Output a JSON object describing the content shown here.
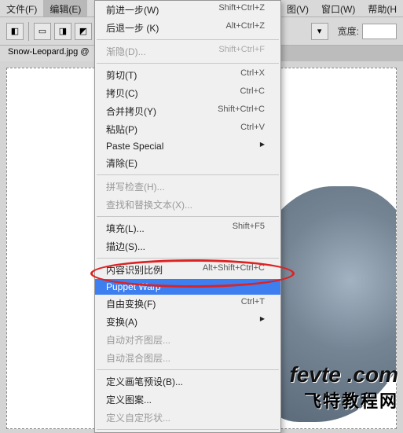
{
  "menubar": {
    "items": [
      "文件(F)",
      "编辑(E)",
      "图(V)",
      "窗口(W)",
      "帮助(H"
    ]
  },
  "toolbar": {
    "width_label": "宽度:"
  },
  "tab": {
    "label": "Snow-Leopard.jpg @"
  },
  "dropdown": {
    "items": [
      {
        "label": "前进一步(W)",
        "shortcut": "Shift+Ctrl+Z",
        "type": "item"
      },
      {
        "label": "后退一步 (K)",
        "shortcut": "Alt+Ctrl+Z",
        "type": "item"
      },
      {
        "type": "sep"
      },
      {
        "label": "渐隐(D)...",
        "shortcut": "Shift+Ctrl+F",
        "type": "item",
        "disabled": true
      },
      {
        "type": "sep"
      },
      {
        "label": "剪切(T)",
        "shortcut": "Ctrl+X",
        "type": "item"
      },
      {
        "label": "拷贝(C)",
        "shortcut": "Ctrl+C",
        "type": "item"
      },
      {
        "label": "合并拷贝(Y)",
        "shortcut": "Shift+Ctrl+C",
        "type": "item"
      },
      {
        "label": "粘贴(P)",
        "shortcut": "Ctrl+V",
        "type": "item"
      },
      {
        "label": "Paste Special",
        "shortcut": "",
        "type": "item",
        "arrow": true
      },
      {
        "label": "清除(E)",
        "shortcut": "",
        "type": "item"
      },
      {
        "type": "sep"
      },
      {
        "label": "拼写检查(H)...",
        "shortcut": "",
        "type": "item",
        "disabled": true
      },
      {
        "label": "查找和替换文本(X)...",
        "shortcut": "",
        "type": "item",
        "disabled": true
      },
      {
        "type": "sep"
      },
      {
        "label": "填充(L)...",
        "shortcut": "Shift+F5",
        "type": "item"
      },
      {
        "label": "描边(S)...",
        "shortcut": "",
        "type": "item"
      },
      {
        "type": "sep"
      },
      {
        "label": "内容识别比例",
        "shortcut": "Alt+Shift+Ctrl+C",
        "type": "item"
      },
      {
        "label": "Puppet Warp",
        "shortcut": "",
        "type": "item",
        "highlight": true
      },
      {
        "label": "自由变换(F)",
        "shortcut": "Ctrl+T",
        "type": "item"
      },
      {
        "label": "变换(A)",
        "shortcut": "",
        "type": "item",
        "arrow": true
      },
      {
        "label": "自动对齐图层...",
        "shortcut": "",
        "type": "item",
        "disabled": true
      },
      {
        "label": "自动混合图层...",
        "shortcut": "",
        "type": "item",
        "disabled": true
      },
      {
        "type": "sep"
      },
      {
        "label": "定义画笔预设(B)...",
        "shortcut": "",
        "type": "item"
      },
      {
        "label": "定义图案...",
        "shortcut": "",
        "type": "item"
      },
      {
        "label": "定义自定形状...",
        "shortcut": "",
        "type": "item",
        "disabled": true
      },
      {
        "type": "sep"
      }
    ]
  },
  "watermark": {
    "line1a": "fevte",
    "line1b": ".com",
    "line2": "飞特教程网"
  }
}
